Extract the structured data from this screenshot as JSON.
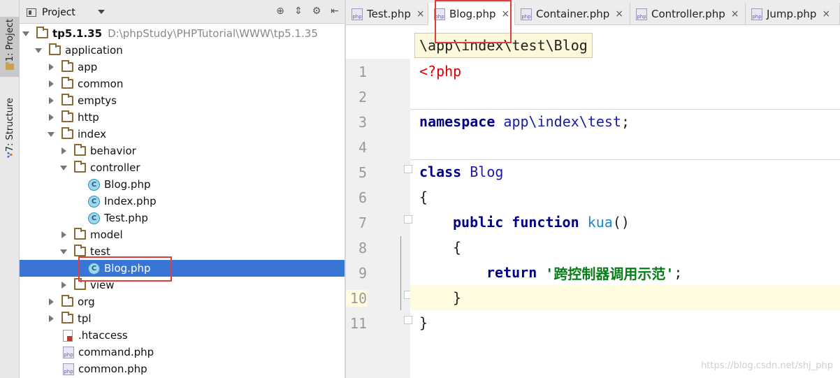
{
  "toolstrip": {
    "project_tab": "1: Project",
    "structure_tab": "7: Structure"
  },
  "project_panel": {
    "title": "Project",
    "tree": [
      {
        "label": "tp5.1.35",
        "path": "D:\\phpStudy\\PHPTutorial\\WWW\\tp5.1.35",
        "type": "root",
        "state": "expanded"
      },
      {
        "label": "application",
        "type": "folder",
        "state": "expanded"
      },
      {
        "label": "app",
        "type": "folder",
        "state": "collapsed"
      },
      {
        "label": "common",
        "type": "folder",
        "state": "collapsed"
      },
      {
        "label": "emptys",
        "type": "folder",
        "state": "collapsed"
      },
      {
        "label": "http",
        "type": "folder",
        "state": "collapsed"
      },
      {
        "label": "index",
        "type": "folder",
        "state": "expanded"
      },
      {
        "label": "behavior",
        "type": "folder",
        "state": "collapsed"
      },
      {
        "label": "controller",
        "type": "folder",
        "state": "expanded"
      },
      {
        "label": "Blog.php",
        "type": "class"
      },
      {
        "label": "Index.php",
        "type": "class"
      },
      {
        "label": "Test.php",
        "type": "class"
      },
      {
        "label": "model",
        "type": "folder",
        "state": "collapsed"
      },
      {
        "label": "test",
        "type": "folder",
        "state": "expanded"
      },
      {
        "label": "Blog.php",
        "type": "class",
        "selected": true
      },
      {
        "label": "view",
        "type": "folder",
        "state": "collapsed"
      },
      {
        "label": "org",
        "type": "folder",
        "state": "collapsed"
      },
      {
        "label": "tpl",
        "type": "folder",
        "state": "collapsed"
      },
      {
        "label": ".htaccess",
        "type": "htaccess"
      },
      {
        "label": "command.php",
        "type": "php"
      },
      {
        "label": "common.php",
        "type": "php"
      }
    ]
  },
  "editor": {
    "tabs": [
      {
        "label": "Test.php"
      },
      {
        "label": "Blog.php",
        "active": true
      },
      {
        "label": "Container.php"
      },
      {
        "label": "Controller.php"
      },
      {
        "label": "Jump.php"
      }
    ],
    "close_glyph": "×",
    "php_icon_text": "php",
    "class_icon_text": "C",
    "breadcrumb": "\\app\\index\\test\\Blog",
    "line_numbers": [
      "1",
      "2",
      "3",
      "4",
      "5",
      "6",
      "7",
      "8",
      "9",
      "10",
      "11"
    ],
    "code": {
      "l1_tag": "<?php",
      "l3_kw": "namespace",
      "l3_ns": "app\\index\\test",
      "l3_semi": ";",
      "l5_kw": "class",
      "l5_name": "Blog",
      "l6_brace": "{",
      "l7_kw1": "public",
      "l7_kw2": "function",
      "l7_fn": "kua",
      "l7_parens": "()",
      "l8_brace": "{",
      "l9_kw": "return",
      "l9_str": "'跨控制器调用示范'",
      "l9_semi": ";",
      "l10_brace": "}",
      "l11_brace": "}"
    }
  },
  "watermark": "https://blog.csdn.net/shj_php",
  "colors": {
    "selection": "#3875d7",
    "highlight_box": "#e23c3c",
    "keyword": "#000080",
    "string": "#067d17"
  }
}
